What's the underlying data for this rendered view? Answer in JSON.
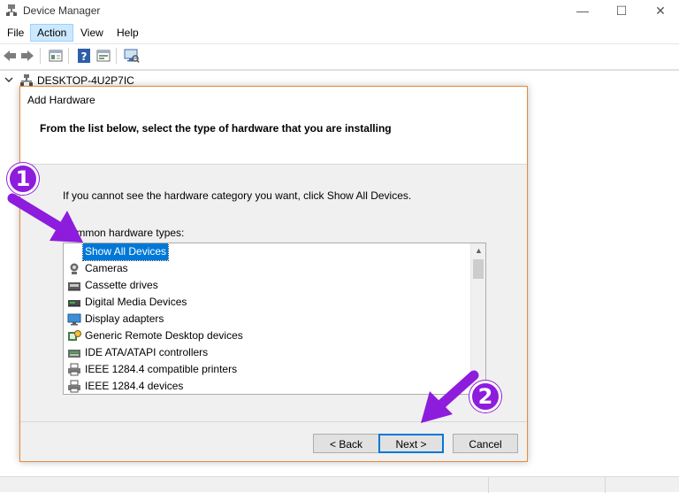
{
  "window": {
    "title": "Device Manager",
    "controls": {
      "minimize": "—",
      "maximize": "☐",
      "close": "✕"
    }
  },
  "menu": [
    "File",
    "Action",
    "View",
    "Help"
  ],
  "toolbar": {
    "buttons": [
      "back-arrow-icon",
      "forward-arrow-icon",
      "properties-icon",
      "help-icon",
      "update-driver-icon",
      "scan-hardware-icon"
    ]
  },
  "tree": {
    "computer_name": "DESKTOP-4U2P7IC"
  },
  "dialog": {
    "title": "Add Hardware",
    "header": "From the list below, select the type of hardware that you are installing",
    "instruction": "If you cannot see the hardware category you want, click Show All Devices.",
    "list_label": "Common hardware types:",
    "items": [
      {
        "label": "Show All Devices",
        "icon": "none",
        "selected": true
      },
      {
        "label": "Cameras",
        "icon": "camera-icon",
        "selected": false
      },
      {
        "label": "Cassette drives",
        "icon": "cassette-drive-icon",
        "selected": false
      },
      {
        "label": "Digital Media Devices",
        "icon": "media-device-icon",
        "selected": false
      },
      {
        "label": "Display adapters",
        "icon": "monitor-icon",
        "selected": false
      },
      {
        "label": "Generic Remote Desktop devices",
        "icon": "remote-desktop-icon",
        "selected": false
      },
      {
        "label": "IDE ATA/ATAPI controllers",
        "icon": "ide-controller-icon",
        "selected": false
      },
      {
        "label": "IEEE 1284.4 compatible printers",
        "icon": "printer-icon",
        "selected": false
      },
      {
        "label": "IEEE 1284.4 devices",
        "icon": "printer-icon",
        "selected": false
      }
    ],
    "buttons": {
      "back": "< Back",
      "next": "Next >",
      "cancel": "Cancel"
    }
  },
  "annotations": {
    "step1": "1",
    "step2": "2",
    "color": "#8e1cdc"
  }
}
